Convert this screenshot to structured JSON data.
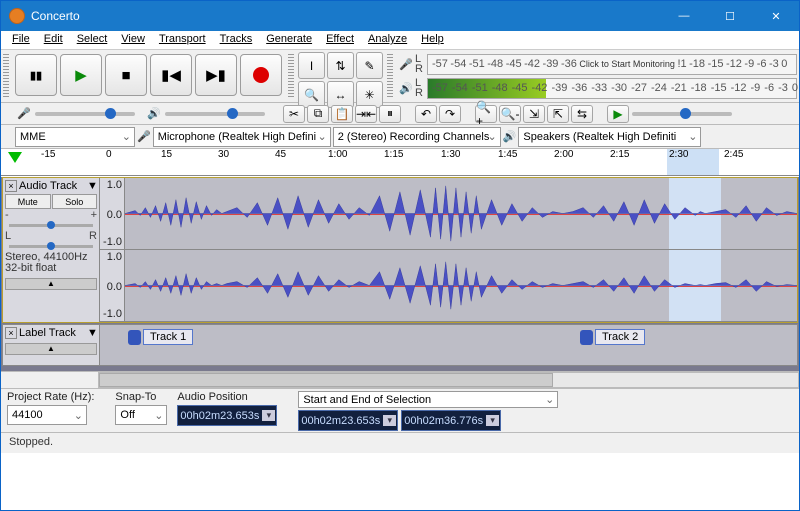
{
  "window": {
    "title": "Concerto"
  },
  "menu": [
    "File",
    "Edit",
    "Select",
    "View",
    "Transport",
    "Tracks",
    "Generate",
    "Effect",
    "Analyze",
    "Help"
  ],
  "meter_ticks": [
    "-57",
    "-54",
    "-51",
    "-48",
    "-45",
    "-42",
    "-39",
    "-36",
    "Click to Start Monitoring",
    "!1",
    "-18",
    "-15",
    "-12",
    "-9",
    "-6",
    "-3",
    "0"
  ],
  "meter_ticks2": [
    "-57",
    "-54",
    "-51",
    "-48",
    "-45",
    "-42",
    "-39",
    "-36",
    "-33",
    "-30",
    "-27",
    "-24",
    "-21",
    "-18",
    "-15",
    "-12",
    "-9",
    "-6",
    "-3",
    "0"
  ],
  "device": {
    "host": "MME",
    "input": "Microphone (Realtek High Defini",
    "channels": "2 (Stereo) Recording Channels",
    "output": "Speakers (Realtek High Definiti"
  },
  "timeline": [
    "-15",
    "0",
    "15",
    "30",
    "45",
    "1:00",
    "1:15",
    "1:30",
    "1:45",
    "2:00",
    "2:15",
    "2:30",
    "2:45"
  ],
  "audio_track": {
    "name": "Audio Track",
    "mute": "Mute",
    "solo": "Solo",
    "l": "L",
    "r": "R",
    "minus": "-",
    "plus": "+",
    "info1": "Stereo, 44100Hz",
    "info2": "32-bit float",
    "scale_top": "1.0",
    "scale_mid": "0.0",
    "scale_bot": "-1.0"
  },
  "label_track": {
    "name": "Label Track",
    "labels": [
      "Track 1",
      "Track 2"
    ]
  },
  "selection": {
    "rate_label": "Project Rate (Hz):",
    "rate": "44100",
    "snap_label": "Snap-To",
    "snap": "Off",
    "pos_label": "Audio Position",
    "range_label": "Start and End of Selection",
    "pos": "00h02m23.653s",
    "start": "00h02m23.653s",
    "end": "00h02m36.776s"
  },
  "status": "Stopped."
}
